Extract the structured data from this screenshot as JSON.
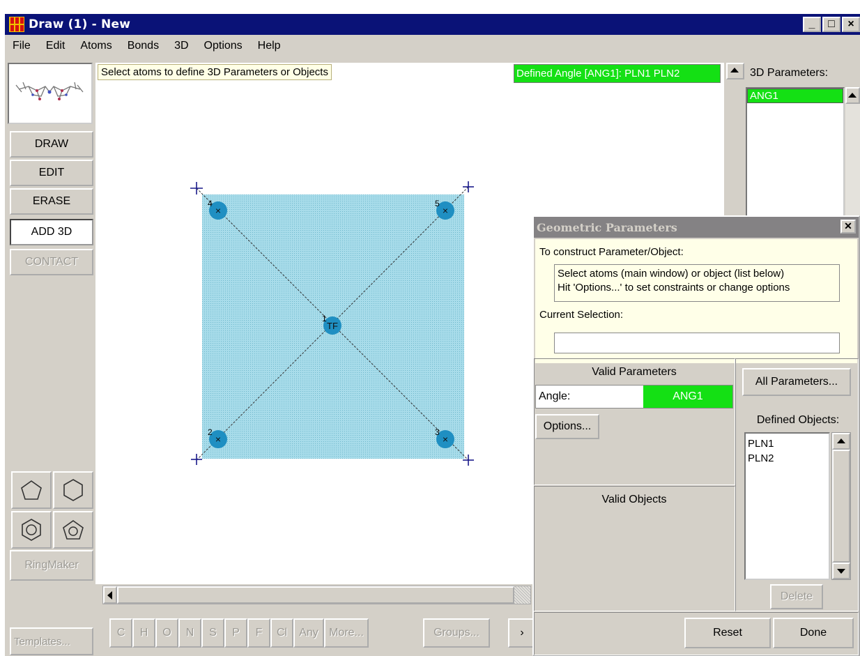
{
  "window": {
    "title": "Draw (1) - New",
    "minimize": "_",
    "maximize": "□",
    "close": "×"
  },
  "menu": [
    "File",
    "Edit",
    "Atoms",
    "Bonds",
    "3D",
    "Options",
    "Help"
  ],
  "left_panel": {
    "modes": [
      "DRAW",
      "EDIT",
      "ERASE",
      "ADD 3D",
      "CONTACT"
    ],
    "active_mode": "ADD 3D",
    "ringmaker": "RingMaker",
    "templates": "Templates..."
  },
  "canvas": {
    "hint": "Select atoms to define 3D Parameters or Objects",
    "defined": "Defined Angle [ANG1]: PLN1 PLN2",
    "atoms": [
      {
        "number": "1",
        "label": "TF"
      },
      {
        "number": "2",
        "label": "×"
      },
      {
        "number": "3",
        "label": "×"
      },
      {
        "number": "4",
        "label": "×"
      },
      {
        "number": "5",
        "label": "×"
      }
    ],
    "plane_color": "#8fcfe0",
    "atom_color": "#1f8fc2"
  },
  "params_panel": {
    "label": "3D Parameters:",
    "items": [
      "ANG1"
    ]
  },
  "elements": {
    "buttons": [
      "C",
      "H",
      "O",
      "N",
      "S",
      "P",
      "F",
      "Cl",
      "Any",
      "More...",
      "Groups..."
    ],
    "next": "›"
  },
  "dialog": {
    "title": "Geometric Parameters",
    "construct_label": "To construct Parameter/Object:",
    "instruction_line1": "Select atoms (main window) or object (list below)",
    "instruction_line2": "Hit 'Options...' to set constraints or change options",
    "current_selection_label": "Current Selection:",
    "current_selection_value": "",
    "valid_parameters_label": "Valid Parameters",
    "angle_key": "Angle:",
    "angle_value": "ANG1",
    "options_button": "Options...",
    "valid_objects_label": "Valid Objects",
    "all_parameters_button": "All Parameters...",
    "defined_objects_label": "Defined Objects:",
    "defined_objects": [
      "PLN1",
      "PLN2"
    ],
    "delete_button": "Delete",
    "reset_button": "Reset",
    "done_button": "Done",
    "highlight_color": "#14e014"
  }
}
